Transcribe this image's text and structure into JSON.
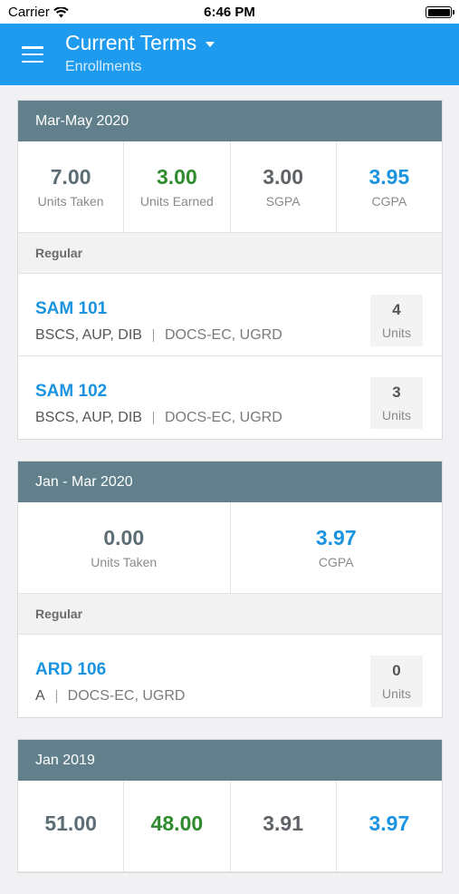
{
  "status": {
    "carrier": "Carrier",
    "time": "6:46 PM"
  },
  "header": {
    "title": "Current Terms",
    "subtitle": "Enrollments"
  },
  "colors": {
    "accent": "#1e9bef",
    "term_header": "#62808c",
    "link": "#1a94e0",
    "earned": "#2e8b2e",
    "neutral": "#5f6368"
  },
  "terms": [
    {
      "label": "Mar-May 2020",
      "stats": [
        {
          "value": "7.00",
          "label": "Units Taken",
          "color": "#5c6d76"
        },
        {
          "value": "3.00",
          "label": "Units Earned",
          "color": "#2e8b2e"
        },
        {
          "value": "3.00",
          "label": "SGPA",
          "color": "#5f6368"
        },
        {
          "value": "3.95",
          "label": "CGPA",
          "color": "#1a94e0"
        }
      ],
      "section": "Regular",
      "courses": [
        {
          "code": "SAM 101",
          "program": "BSCS, AUP, DIB",
          "org": "DOCS-EC, UGRD",
          "units": "4",
          "units_label": "Units"
        },
        {
          "code": "SAM 102",
          "program": "BSCS, AUP, DIB",
          "org": "DOCS-EC, UGRD",
          "units": "3",
          "units_label": "Units"
        }
      ]
    },
    {
      "label": "Jan - Mar 2020",
      "stats": [
        {
          "value": "0.00",
          "label": "Units Taken",
          "color": "#5c6d76"
        },
        {
          "value": "3.97",
          "label": "CGPA",
          "color": "#1a94e0"
        }
      ],
      "section": "Regular",
      "courses": [
        {
          "code": "ARD 106",
          "program": "A",
          "org": "DOCS-EC, UGRD",
          "units": "0",
          "units_label": "Units"
        }
      ]
    },
    {
      "label": "Jan 2019",
      "stats": [
        {
          "value": "51.00",
          "label": "",
          "color": "#5c6d76"
        },
        {
          "value": "48.00",
          "label": "",
          "color": "#2e8b2e"
        },
        {
          "value": "3.91",
          "label": "",
          "color": "#5f6368"
        },
        {
          "value": "3.97",
          "label": "",
          "color": "#1a94e0"
        }
      ]
    }
  ]
}
